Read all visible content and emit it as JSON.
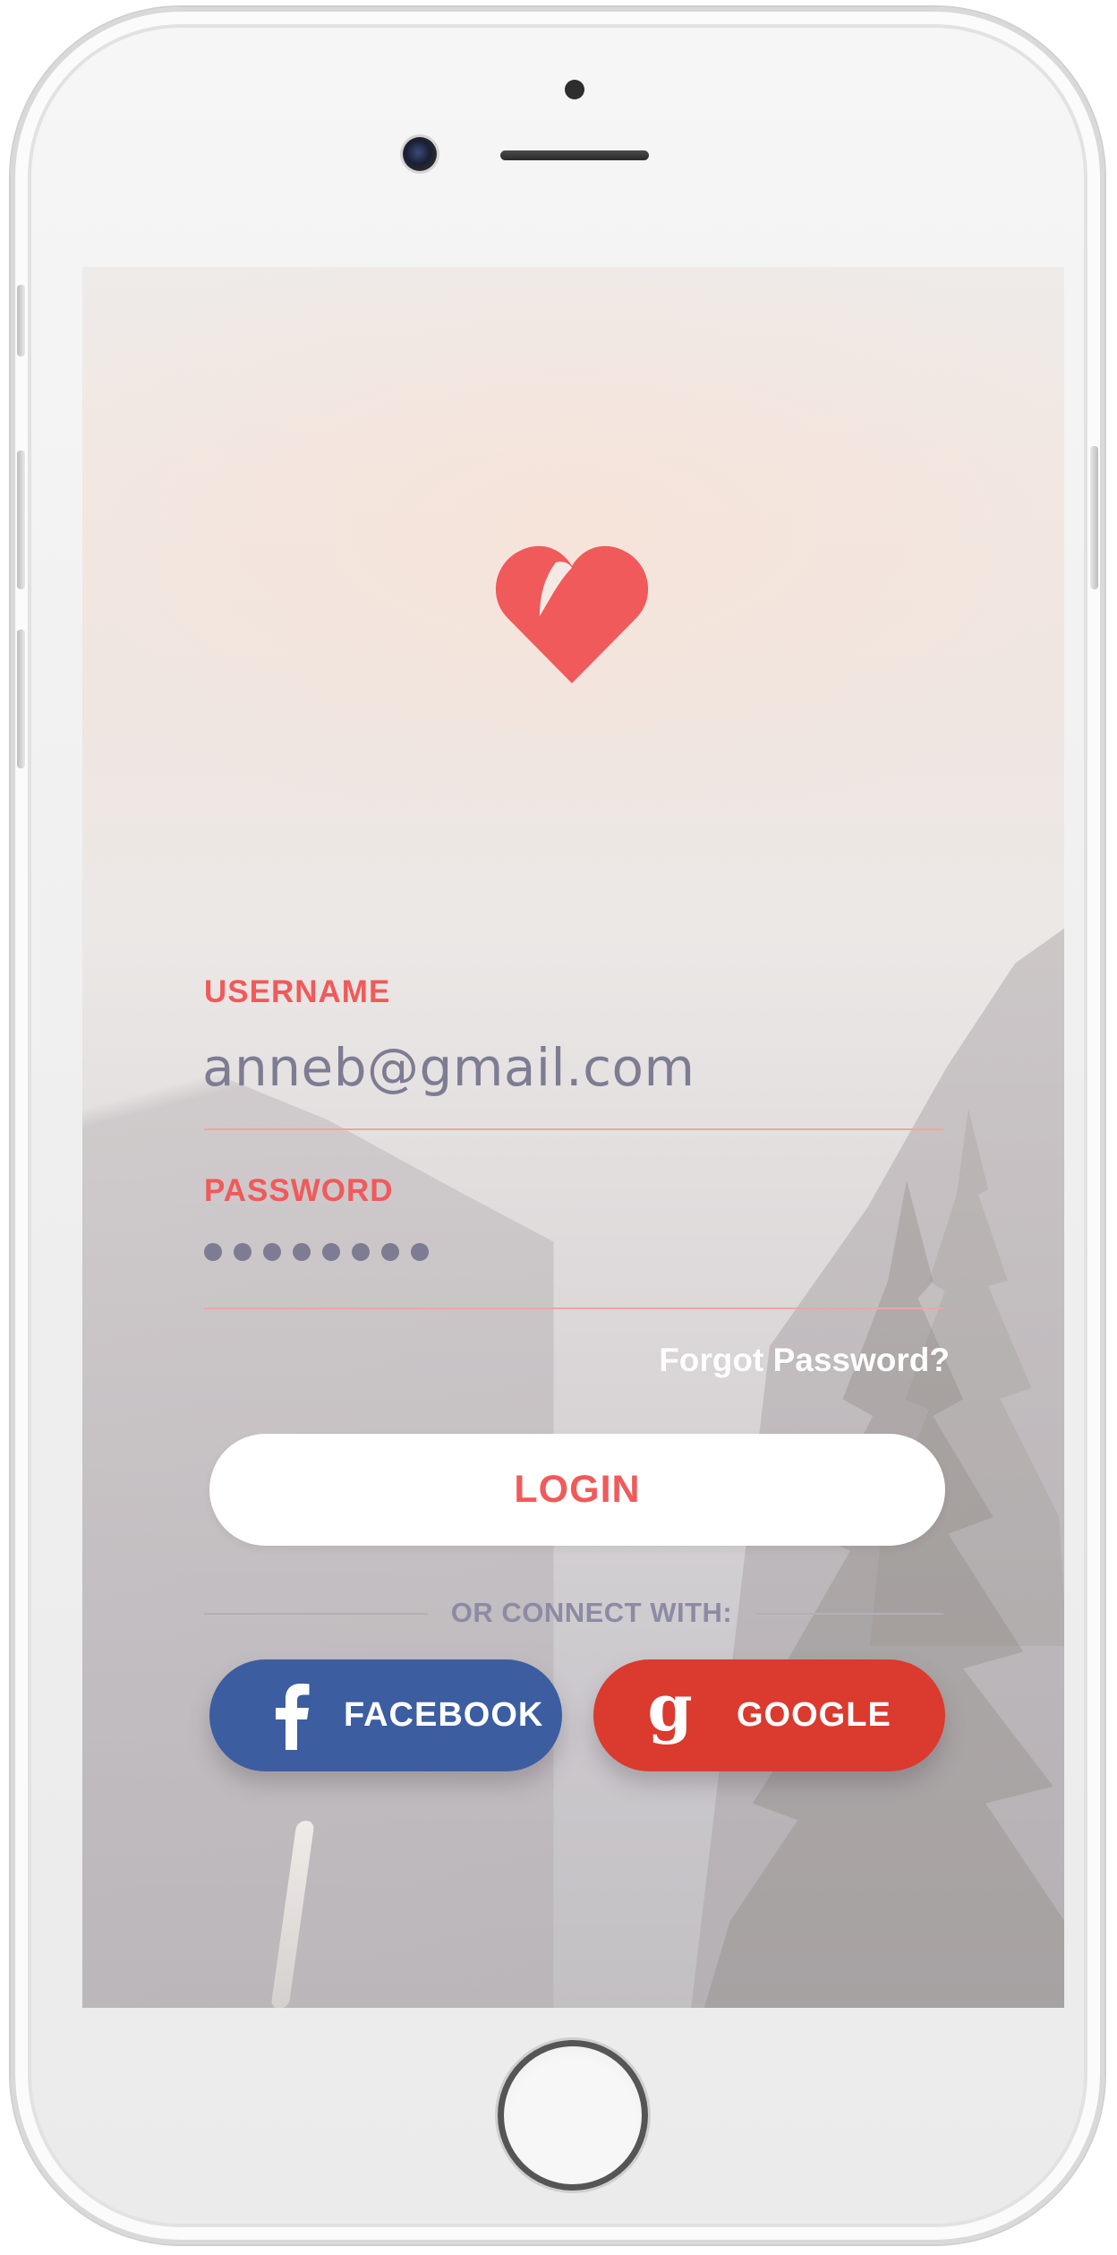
{
  "login": {
    "username_label": "USERNAME",
    "username_value": "anneb@gmail.com",
    "password_label": "PASSWORD",
    "password_masked_length": 8,
    "forgot_password": "Forgot Password?",
    "login_button": "LOGIN"
  },
  "social": {
    "divider_text": "OR CONNECT WITH:",
    "facebook_label": "FACEBOOK",
    "google_label": "GOOGLE"
  },
  "icons": {
    "logo": "heart-icon",
    "facebook": "facebook-f-icon",
    "google": "google-g-icon"
  },
  "colors": {
    "accent": "#f05a5b",
    "facebook": "#3c5da0",
    "google": "#db3a2f",
    "input_text": "#7d7c92"
  }
}
